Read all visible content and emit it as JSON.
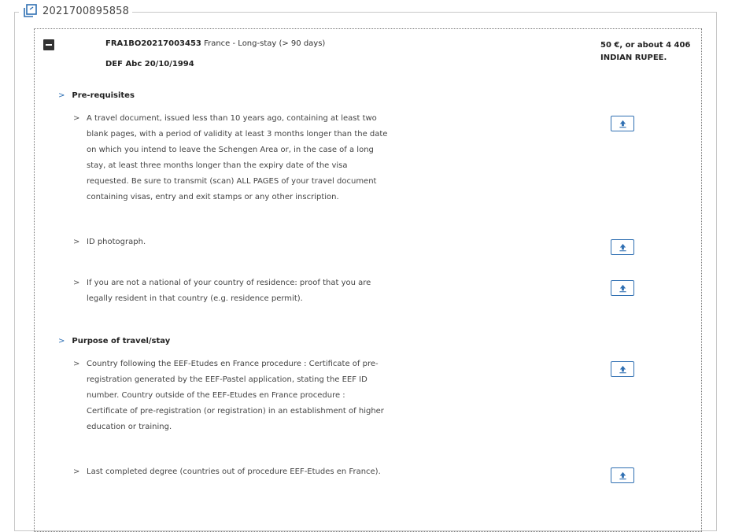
{
  "application": {
    "number": "2021700895858"
  },
  "visa": {
    "reference": "FRA1BO20217003453",
    "type": "France - Long-stay (> 90 days)",
    "applicant": "DEF Abc 20/10/1994",
    "fee": "50 €, or about 4 406 INDIAN RUPEE."
  },
  "sections": [
    {
      "title": "Pre-requisites",
      "items": [
        {
          "text": "A travel document, issued less than 10 years ago, containing at least two blank pages, with a period of validity at least 3 months longer than the date on which you intend to leave the Schengen Area or, in the case of a long stay, at least three months longer than the expiry date of the visa requested. Be sure to transmit (scan) ALL PAGES of your travel document containing visas, entry and exit stamps or any other inscription."
        },
        {
          "text": "ID photograph."
        },
        {
          "text": "If you are not a national of your country of residence: proof that you are legally resident in that country (e.g. residence permit)."
        }
      ]
    },
    {
      "title": "Purpose of travel/stay",
      "items": [
        {
          "text": "Country following the EEF-Etudes en France procedure : Certificate of pre-registration generated by the EEF-Pastel application, stating the EEF ID number. Country outside of the EEF-Etudes en France procedure : Certificate of pre-registration (or registration) in an establishment of higher education or training."
        },
        {
          "text": "Last completed degree (countries out of procedure EEF-Etudes en France)."
        }
      ]
    }
  ],
  "icons": {
    "legend": "copy-document-icon",
    "collapse": "minus-square-icon",
    "chevron": "chevron-right-icon",
    "upload": "upload-icon"
  },
  "colors": {
    "accent": "#2f6fb2",
    "text": "#333333",
    "border": "#c8c8c8"
  }
}
